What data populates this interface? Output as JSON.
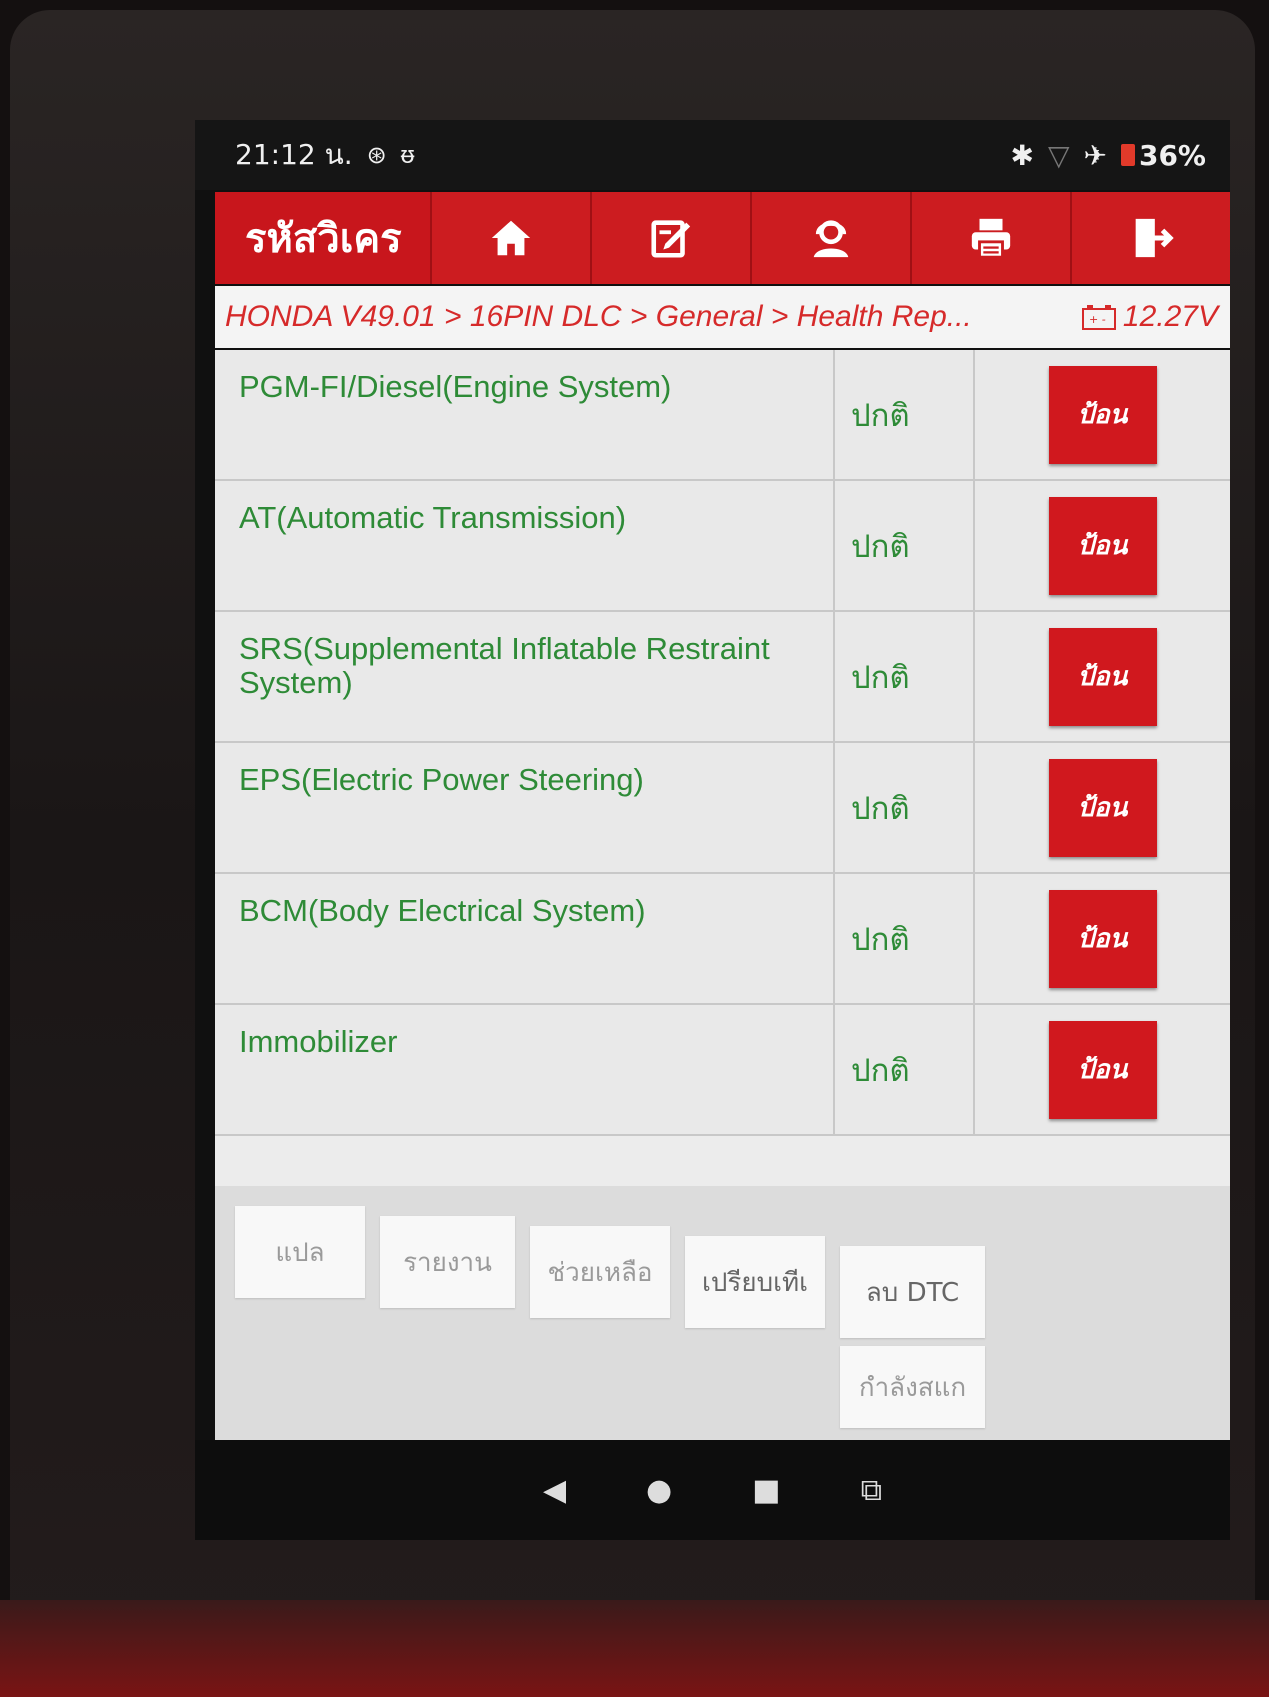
{
  "status_bar": {
    "time": "21:12 น.",
    "battery_percent": "36%",
    "icons": [
      "bluetooth-icon",
      "wifi-icon",
      "airplane-mode-icon",
      "battery-icon"
    ]
  },
  "header": {
    "title": "รหัสวิเคร",
    "buttons": [
      "home-icon",
      "edit-icon",
      "support-agent-icon",
      "printer-icon",
      "exit-icon"
    ],
    "accent_color": "#c8161c"
  },
  "breadcrumb": {
    "path": "HONDA V49.01 > 16PIN DLC > General > Health Rep...",
    "voltage": "12.27V"
  },
  "systems": [
    {
      "name": "PGM-FI/Diesel(Engine System)",
      "status": "ปกติ",
      "action": "ป้อน"
    },
    {
      "name": "AT(Automatic Transmission)",
      "status": "ปกติ",
      "action": "ป้อน"
    },
    {
      "name": "SRS(Supplemental Inflatable Restraint System)",
      "status": "ปกติ",
      "action": "ป้อน"
    },
    {
      "name": "EPS(Electric Power Steering)",
      "status": "ปกติ",
      "action": "ป้อน"
    },
    {
      "name": "BCM(Body Electrical System)",
      "status": "ปกติ",
      "action": "ป้อน"
    },
    {
      "name": "Immobilizer",
      "status": "ปกติ",
      "action": "ป้อน"
    }
  ],
  "toolbar": {
    "translate": "แปล",
    "report": "รายงาน",
    "help": "ช่วยเหลือ",
    "compare": "เปรียบเทีเ",
    "clear_dtc": "ลบ DTC",
    "scanning": "กำลังสแก"
  },
  "nav": [
    "back-icon",
    "home-circle-icon",
    "recents-icon",
    "screenshot-icon"
  ],
  "colors": {
    "status_green": "#2e8b37",
    "button_red": "#d0181e"
  }
}
